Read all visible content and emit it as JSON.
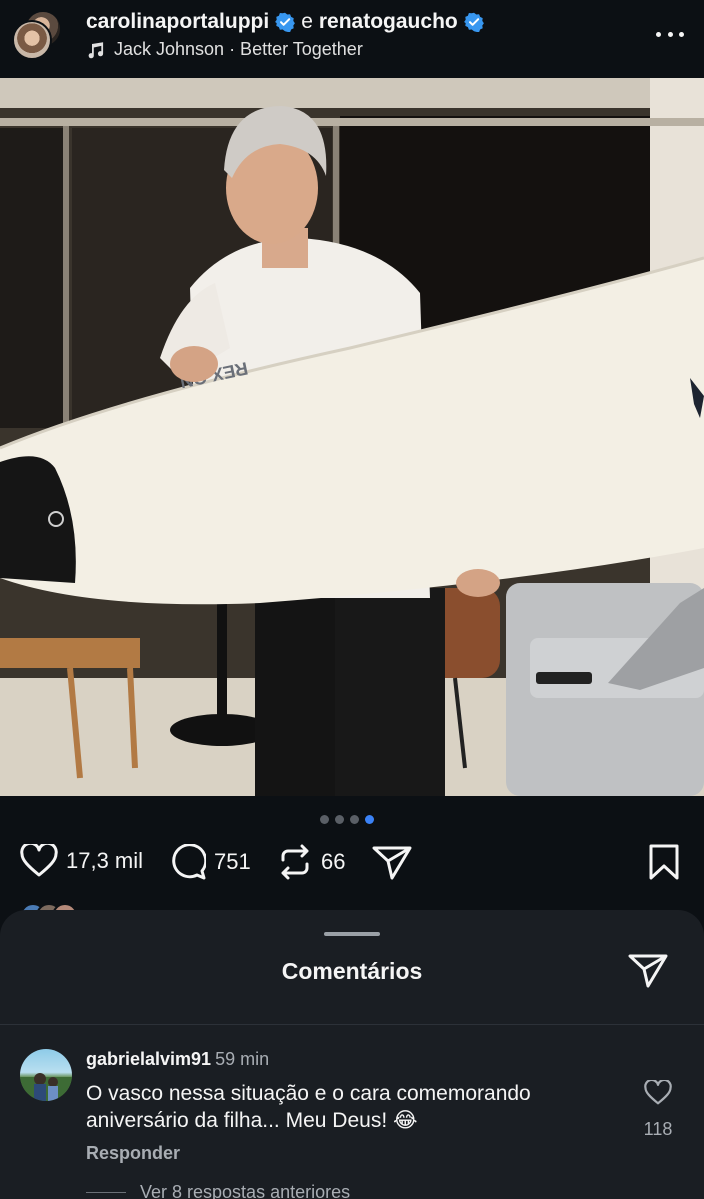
{
  "header": {
    "user1": "carolinaportaluppi",
    "connector": "e",
    "user2": "renatogaucho",
    "music": "Jack Johnson · Better Together",
    "icons": [
      "music-note-icon",
      "verified-badge-icon",
      "more-options-icon"
    ]
  },
  "media": {
    "surfboard_brand": "REX ON",
    "carousel_count": 4,
    "carousel_active_index": 3
  },
  "actions": {
    "likes": "17,3 mil",
    "comments": "751",
    "reposts": "66"
  },
  "comments_sheet": {
    "title": "Comentários",
    "comment": {
      "username": "gabrielalvim91",
      "time": "59 min",
      "text": "O vasco nessa situação e o cara comemorando aniversário da filha... Meu Deus! 😂",
      "reply_label": "Responder",
      "like_count": "118"
    },
    "view_replies": "Ver 8 respostas anteriores"
  },
  "colors": {
    "background": "#0c1014",
    "sheet": "#1a1e23",
    "verified": "#3897f0",
    "active_dot": "#3b82f6",
    "muted_text": "#a8adb3"
  }
}
